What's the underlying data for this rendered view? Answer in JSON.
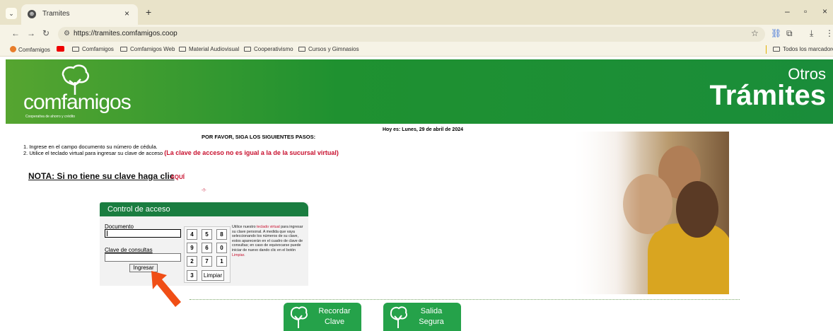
{
  "browser": {
    "tab_title": "Tramites",
    "url": "https://tramites.comfamigos.coop",
    "bookmarks": [
      "Comfamigos",
      "Comfamigos",
      "Comfamigos Web",
      "Material Audiovisual",
      "Cooperativismo",
      "Cursos y Gimnasios"
    ],
    "all_bookmarks": "Todos los marcadores"
  },
  "banner": {
    "logo_text": "comfamigos",
    "logo_subtitle": "Cooperativa de ahorro y crédito",
    "title_line1": "Otros",
    "title_line2": "Trámites"
  },
  "content": {
    "date": "Hoy es: Lunes, 29 de abril de 2024",
    "steps_heading": "POR FAVOR, SIGA LOS SIGUIENTES PASOS:",
    "step1": "1. Ingrese en el campo documento su número de cédula.",
    "step2": "2. Utilice el teclado virtual para ingresar su clave de acceso",
    "step2_warning": "(La clave de acceso no es igual a la de la sucursal virtual)",
    "note": "NOTA: Si no tiene su clave haga clic",
    "note_link": "AQUÍ",
    "red_mark": "-!-"
  },
  "login": {
    "title": "Control de acceso",
    "doc_label": "Documento",
    "key_label": "Clave de consultas",
    "submit_label": "Ingresar",
    "keypad_rows": [
      [
        "4",
        "5",
        "8"
      ],
      [
        "9",
        "6",
        "0"
      ],
      [
        "2",
        "7",
        "1"
      ]
    ],
    "keypad_last": "3",
    "clear_label": "Limpiar",
    "help_part1": "Utilice nuestro ",
    "help_link": "teclado virtual",
    "help_part2": " para ingresar su clave personal. A medida que vaya seleccionando los números de su clave, estos aparecerán en el cuadro de clave de consultas; en caso de equivocarse puede iniciar de nuevo dando clic en el botón ",
    "help_clear": "Limpiar",
    "help_end": "."
  },
  "actions": {
    "remember_l1": "Recordar",
    "remember_l2": "Clave",
    "exit_l1": "Salida",
    "exit_l2": "Segura"
  },
  "colors": {
    "brand_green": "#1a8d3a",
    "accent_red": "#c8102e",
    "arrow_orange": "#f04e16"
  }
}
